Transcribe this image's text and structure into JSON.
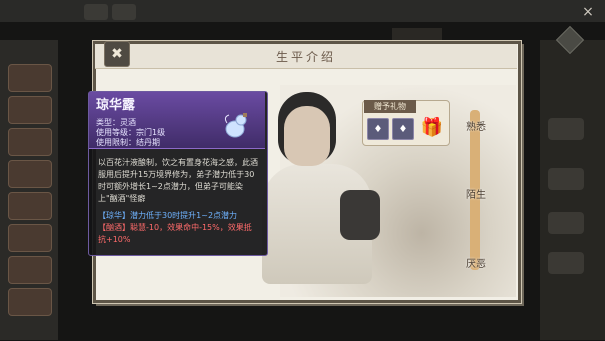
{
  "background": {
    "left_buttons": [
      "",
      "",
      "",
      "",
      "",
      "",
      "",
      "",
      ""
    ],
    "close_glyph": "×",
    "tab_label": ""
  },
  "panel": {
    "title": "生平介绍",
    "back_glyph": "✖"
  },
  "gifts": {
    "label": "赠予礼物",
    "item_glyph": "♦",
    "box_glyph": "🎁"
  },
  "side_marks": {
    "top": "熟悉",
    "middle": "陌生",
    "bottom": "厌恶"
  },
  "tooltip": {
    "title": "琼华露",
    "type_label": "类型：",
    "type_value": "灵酒",
    "level_label": "使用等级：",
    "level_value": "宗门1级",
    "limit_label": "使用限制：",
    "limit_value": "结丹期",
    "icon_name": "wine-gourd-icon",
    "description": "以百花汁液酿制，饮之有置身花海之感，此酒服用后提升15万境界修为，弟子潜力低于30时可额外增长1~2点潜力，但弟子可能染上\"酗酒\"怪癖",
    "effect1": "【琼华】潜力低于30时提升1~2点潜力",
    "effect2": "【酗酒】聪慧-10，效果命中-15%，效果抵抗+10%"
  },
  "colors": {
    "accent_purple": "#5b3e91",
    "effect1_color": "#6fb3ff",
    "effect2_color": "#ff6b6b"
  }
}
